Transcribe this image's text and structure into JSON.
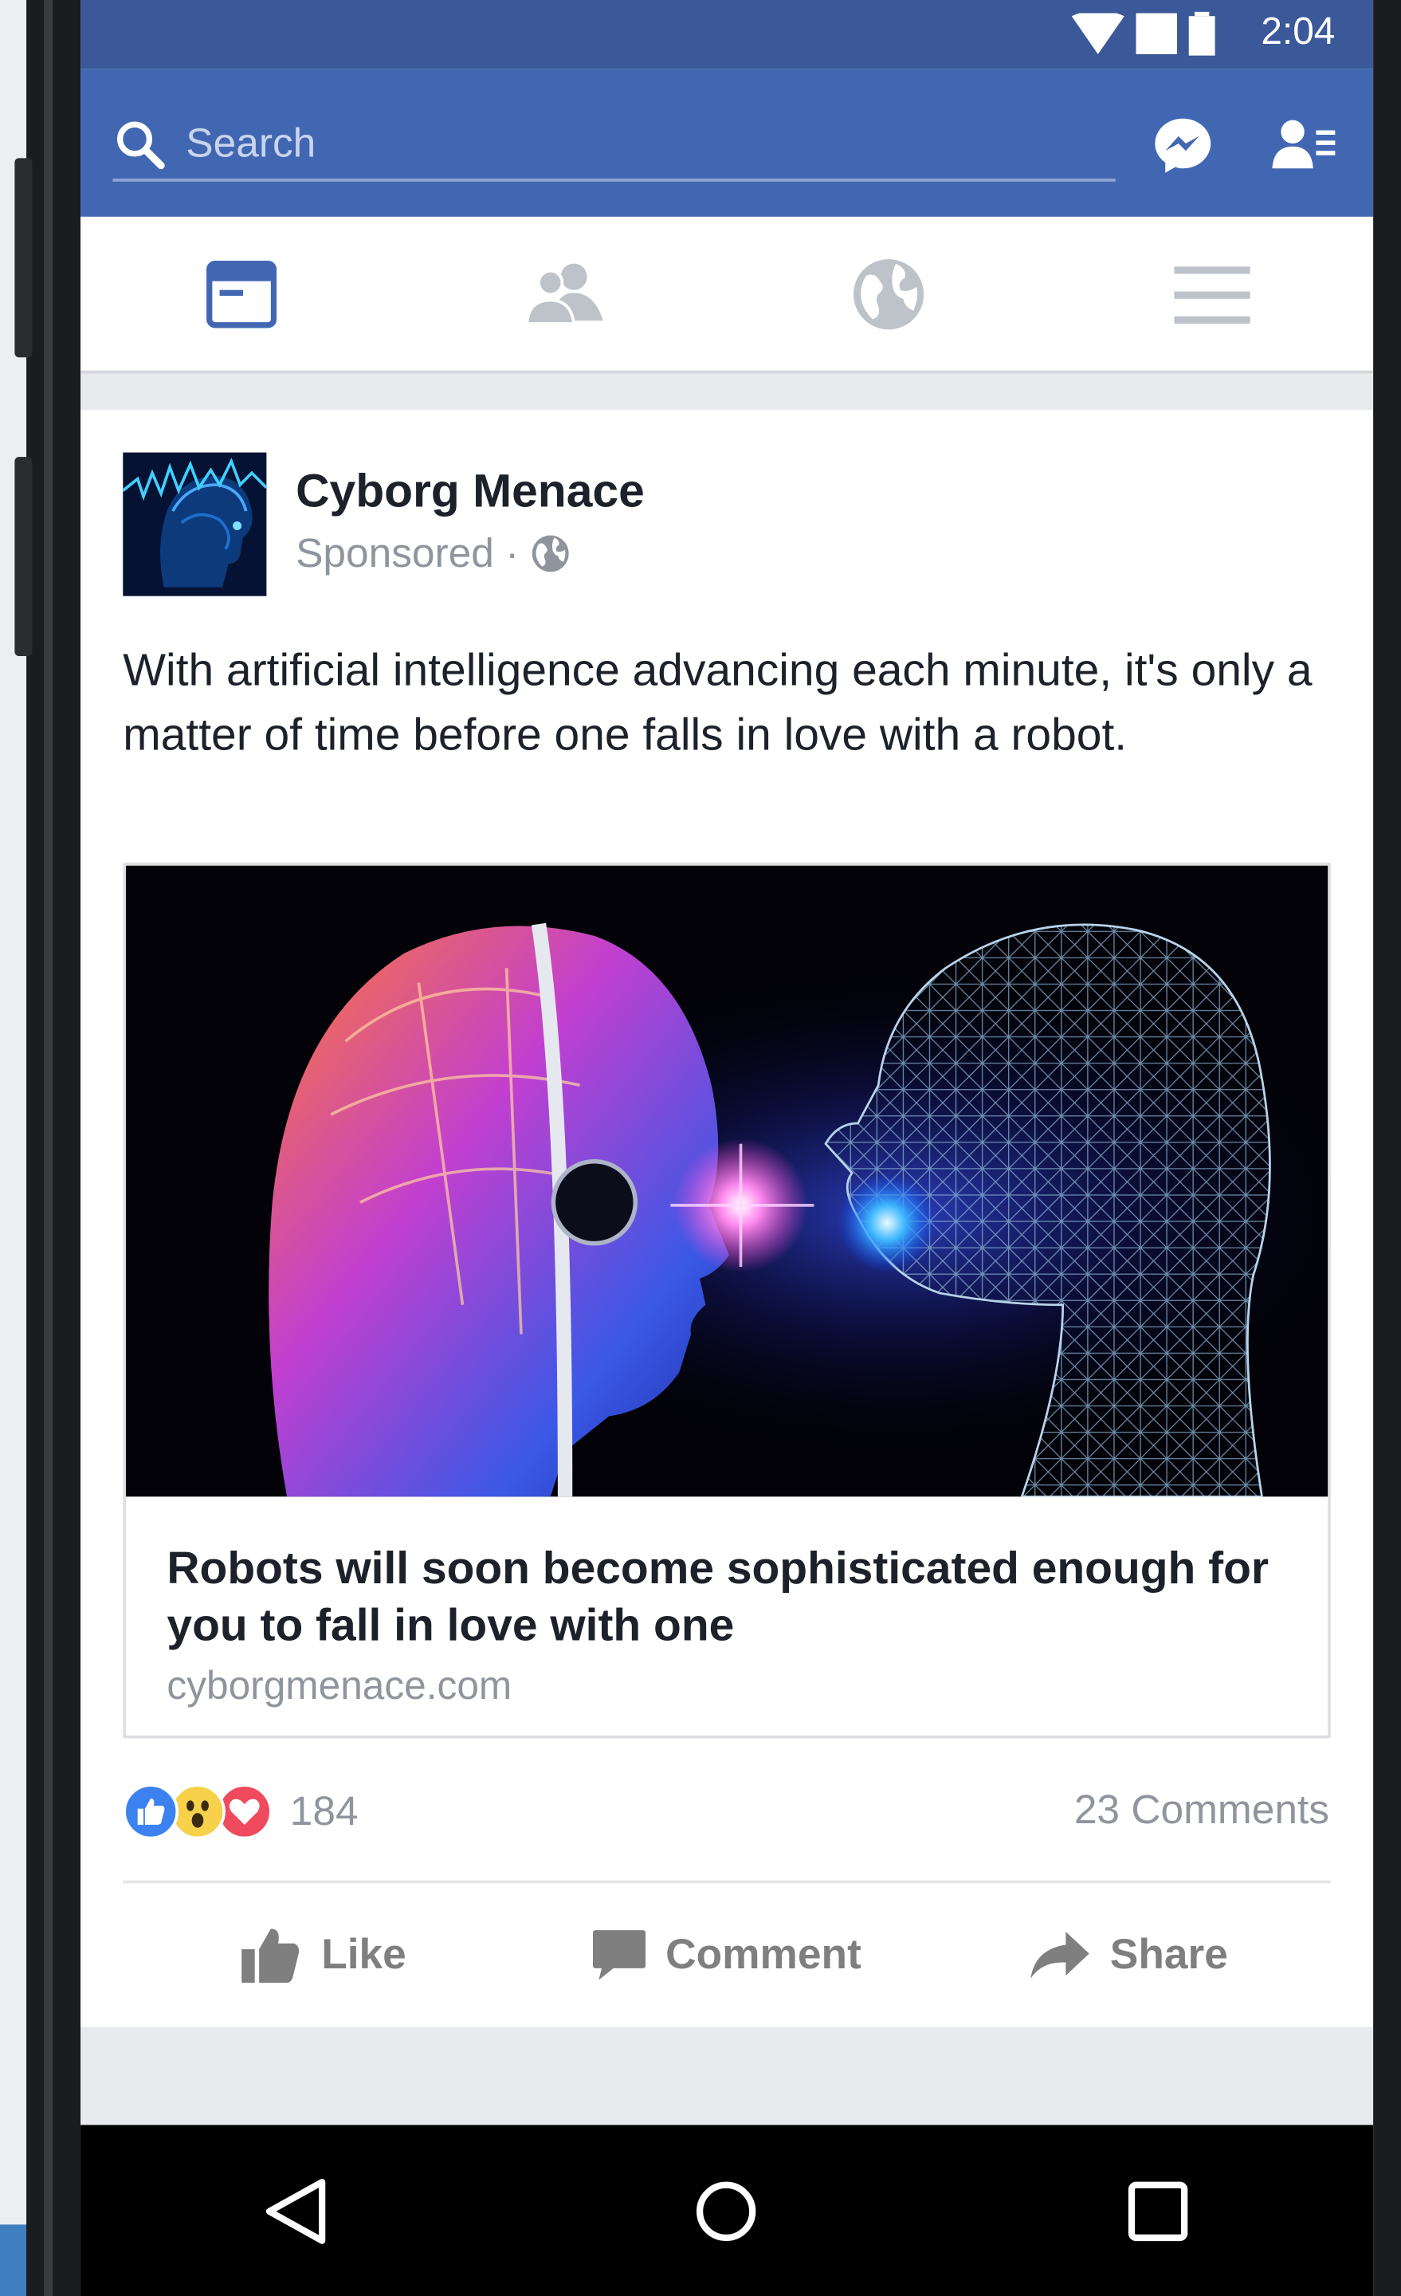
{
  "status_bar": {
    "time": "2:04"
  },
  "search": {
    "placeholder": "Search"
  },
  "nav_tabs": [
    {
      "name": "news-feed",
      "icon": "news-feed-icon",
      "active": true
    },
    {
      "name": "friends",
      "icon": "friends-icon",
      "active": false
    },
    {
      "name": "notifications",
      "icon": "globe-icon",
      "active": false
    },
    {
      "name": "menu",
      "icon": "hamburger-menu-icon",
      "active": false
    }
  ],
  "post": {
    "page_name": "Cyborg Menace",
    "meta": "Sponsored ·",
    "text": "With artificial intelligence advancing each minute, it's only a matter of time before one falls in love with a robot.",
    "link": {
      "title": "Robots will soon become sophisticated enough for you to fall in love with one",
      "domain": "cyborgmenace.com"
    },
    "reactions_count": "184",
    "comments": "23 Comments",
    "actions": {
      "like": "Like",
      "comment": "Comment",
      "share": "Share"
    }
  },
  "colors": {
    "brand": "#3b5998",
    "header": "#4267b2",
    "text": "#1d2129",
    "muted": "#90949c",
    "active_tab": "#4267b2"
  }
}
